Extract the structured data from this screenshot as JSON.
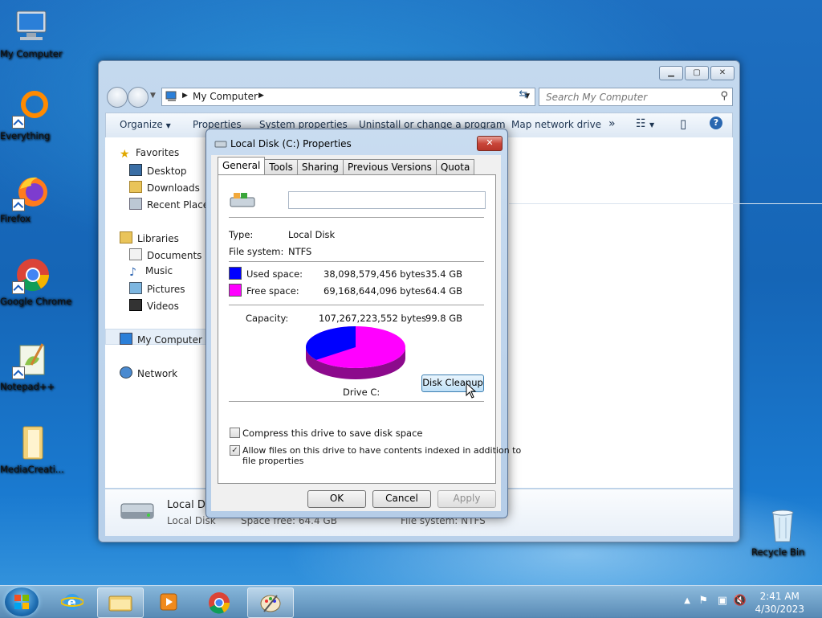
{
  "desktop": {
    "icons": [
      {
        "label": "My Computer"
      },
      {
        "label": "Everything"
      },
      {
        "label": "Firefox"
      },
      {
        "label": "Google Chrome"
      },
      {
        "label": "Notepad++"
      },
      {
        "label": "MediaCreati..."
      },
      {
        "label": "Recycle Bin"
      }
    ]
  },
  "explorer": {
    "address": "My Computer",
    "search_placeholder": "Search My Computer",
    "toolbar": {
      "organize": "Organize",
      "properties": "Properties",
      "system_properties": "System properties",
      "uninstall": "Uninstall or change a program",
      "map_drive": "Map network drive",
      "more": "»"
    },
    "nav": {
      "favorites": "Favorites",
      "desktop": "Desktop",
      "downloads": "Downloads",
      "recent": "Recent Places",
      "libraries": "Libraries",
      "documents": "Documents",
      "music": "Music",
      "pictures": "Pictures",
      "videos": "Videos",
      "my_computer": "My Computer",
      "network": "Network"
    },
    "details": {
      "name": "Local Disk (C:)",
      "type": "Local Disk",
      "space_free": "Space free: 64.4 GB",
      "file_system": "File system: NTFS"
    }
  },
  "dialog": {
    "title": "Local Disk (C:) Properties",
    "close": "✕",
    "tabs": [
      "General",
      "Tools",
      "Sharing",
      "Previous Versions",
      "Quota"
    ],
    "name_value": "",
    "type_label": "Type:",
    "type_value": "Local Disk",
    "fs_label": "File system:",
    "fs_value": "NTFS",
    "used_label": "Used space:",
    "used_bytes": "38,098,579,456 bytes",
    "used_gb": "35.4 GB",
    "free_label": "Free space:",
    "free_bytes": "69,168,644,096 bytes",
    "free_gb": "64.4 GB",
    "capacity_label": "Capacity:",
    "capacity_bytes": "107,267,223,552 bytes",
    "capacity_gb": "99.8 GB",
    "drive_label": "Drive C:",
    "disk_cleanup": "Disk Cleanup",
    "compress_label": "Compress this drive to save disk space",
    "index_label_1": "Allow files on this drive to have contents indexed in addition to",
    "index_label_2": "file properties",
    "index_checked": "✓",
    "ok": "OK",
    "cancel": "Cancel",
    "apply": "Apply",
    "colors": {
      "used": "#0000ff",
      "free": "#ff00ff"
    },
    "used_fraction": 0.355
  },
  "taskbar": {
    "time": "2:41 AM",
    "date": "4/30/2023"
  }
}
